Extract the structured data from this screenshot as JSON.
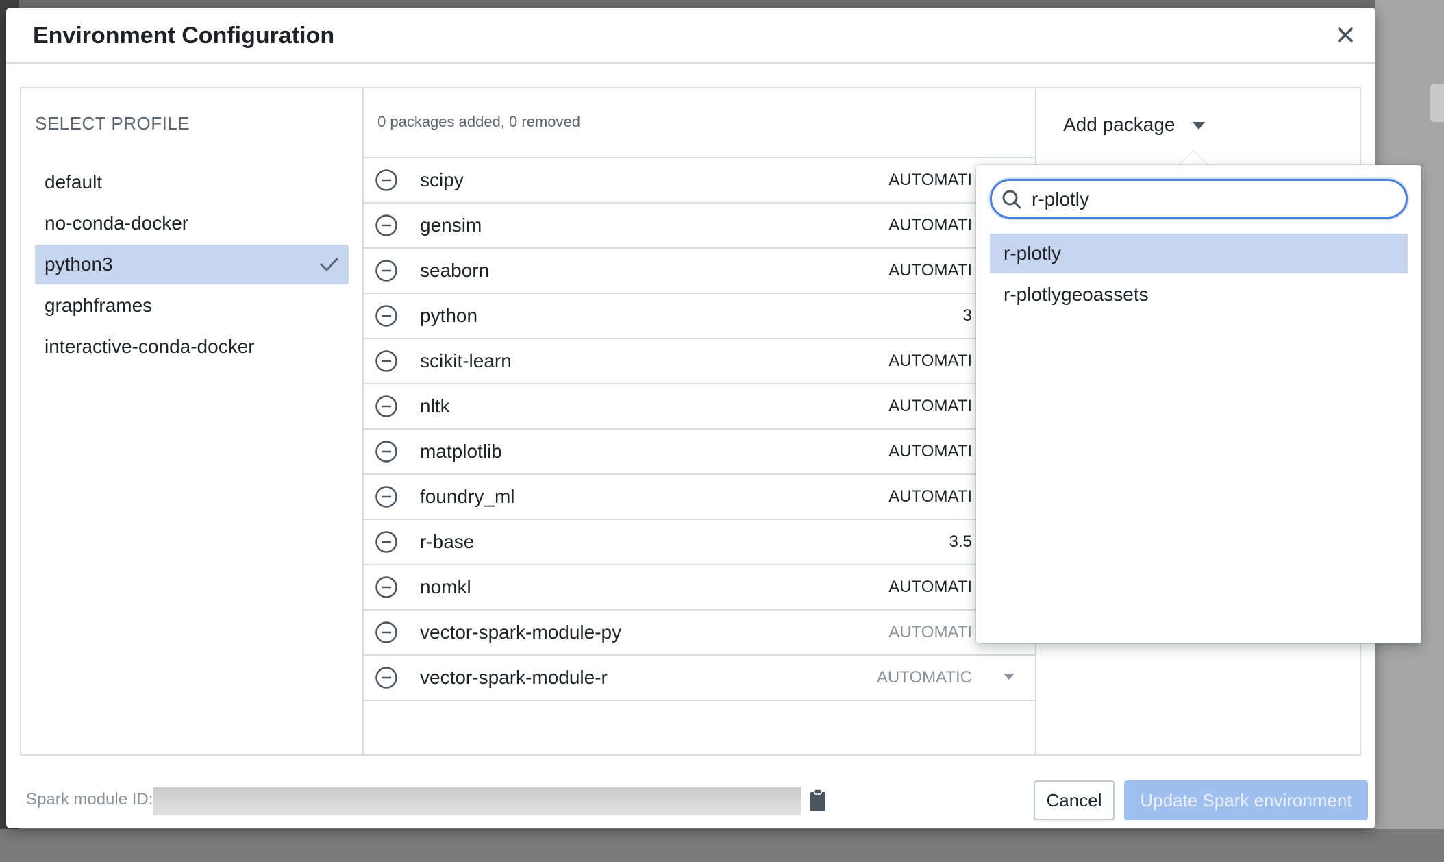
{
  "modal": {
    "title": "Environment Configuration",
    "close_icon": "close-icon"
  },
  "profiles": {
    "heading": "SELECT PROFILE",
    "items": [
      {
        "label": "default",
        "selected": false
      },
      {
        "label": "no-conda-docker",
        "selected": false
      },
      {
        "label": "python3",
        "selected": true
      },
      {
        "label": "graphframes",
        "selected": false
      },
      {
        "label": "interactive-conda-docker",
        "selected": false
      }
    ]
  },
  "packages": {
    "summary": "0 packages added, 0 removed",
    "rows": [
      {
        "name": "scipy",
        "version": "AUTOMATI"
      },
      {
        "name": "gensim",
        "version": "AUTOMATI"
      },
      {
        "name": "seaborn",
        "version": "AUTOMATI"
      },
      {
        "name": "python",
        "version": "3"
      },
      {
        "name": "scikit-learn",
        "version": "AUTOMATI"
      },
      {
        "name": "nltk",
        "version": "AUTOMATI"
      },
      {
        "name": "matplotlib",
        "version": "AUTOMATI"
      },
      {
        "name": "foundry_ml",
        "version": "AUTOMATI"
      },
      {
        "name": "r-base",
        "version": "3.5"
      },
      {
        "name": "nomkl",
        "version": "AUTOMATI"
      },
      {
        "name": "vector-spark-module-py",
        "version": "AUTOMATI"
      },
      {
        "name": "vector-spark-module-r",
        "version": "AUTOMATIC"
      }
    ]
  },
  "add_package": {
    "label": "Add package",
    "search_value": "r-plotly",
    "results": [
      {
        "label": "r-plotly",
        "active": true
      },
      {
        "label": "r-plotlygeoassets",
        "active": false
      }
    ]
  },
  "footer": {
    "module_id_label": "Spark module ID:",
    "cancel_label": "Cancel",
    "update_label": "Update Spark environment"
  },
  "colors": {
    "accent": "#4a7fd6",
    "selected_bg": "#c7d5ef",
    "primary_disabled": "#9fc0ef"
  }
}
